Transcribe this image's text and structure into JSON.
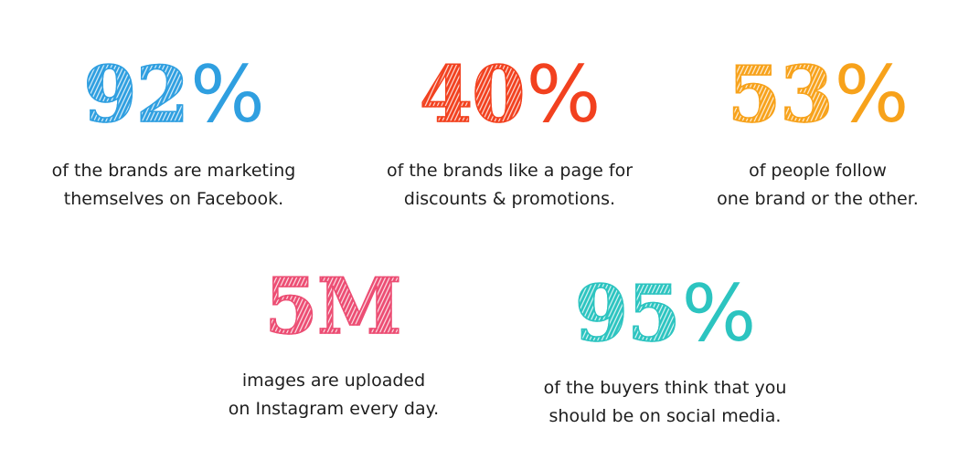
{
  "stats": [
    {
      "number": "92",
      "unit": "%",
      "color": "#2f9fe0",
      "line1": "of the brands are marketing",
      "line2": "themselves on Facebook."
    },
    {
      "number": "40",
      "unit": "%",
      "color": "#f2411f",
      "line1": "of the brands like a page for",
      "line2": "discounts & promotions."
    },
    {
      "number": "53",
      "unit": "%",
      "color": "#f7a21b",
      "line1": "of people follow",
      "line2": "one brand or the other."
    },
    {
      "number": "5M",
      "unit": "",
      "color": "#ec4d73",
      "line1": "images are uploaded",
      "line2": "on Instagram every day."
    },
    {
      "number": "95",
      "unit": "%",
      "color": "#2cc4c0",
      "line1": "of the buyers think that you",
      "line2": "should be on social media."
    }
  ]
}
